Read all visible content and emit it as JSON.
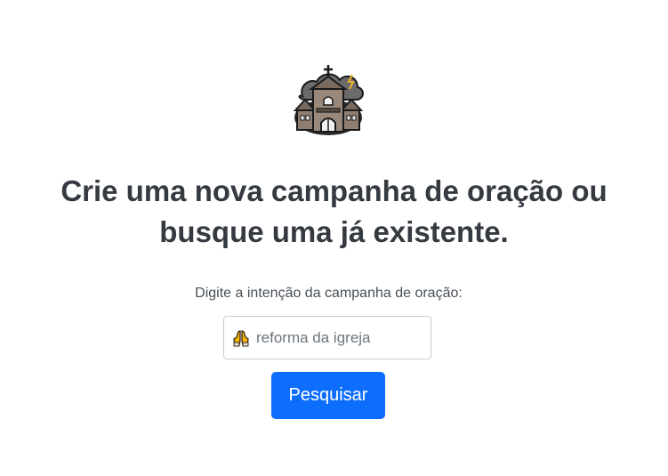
{
  "logo": {
    "icon": "church-icon"
  },
  "headline": {
    "line1": "Crie uma nova campanha de oração ou",
    "line2": "busque uma já existente."
  },
  "search": {
    "label": "Digite a intenção da campanha de oração:",
    "placeholder": "reforma da igreja",
    "value": "",
    "prefix_icon": "praying-hands-icon",
    "button_label": "Pesquisar"
  },
  "colors": {
    "primary": "#0d6efd",
    "text": "#343a40"
  }
}
